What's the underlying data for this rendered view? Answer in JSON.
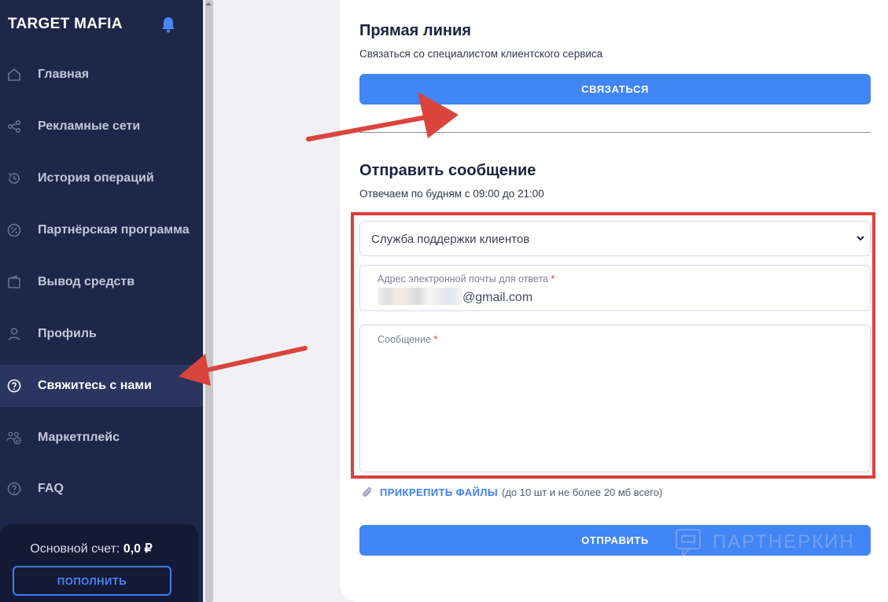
{
  "sidebar": {
    "brand": "TARGET MAFIA",
    "items": [
      {
        "label": "Главная",
        "icon": "home-icon"
      },
      {
        "label": "Рекламные сети",
        "icon": "share-icon"
      },
      {
        "label": "История операций",
        "icon": "history-icon"
      },
      {
        "label": "Партнёрская программа",
        "icon": "percent-icon"
      },
      {
        "label": "Вывод средств",
        "icon": "wallet-icon"
      },
      {
        "label": "Профиль",
        "icon": "user-icon"
      },
      {
        "label": "Свяжитесь с нами",
        "icon": "question-icon",
        "active": true
      },
      {
        "label": "Маркетплейс",
        "icon": "users-icon"
      },
      {
        "label": "FAQ",
        "icon": "question-icon"
      }
    ],
    "balance": {
      "label": "Основной счет:",
      "value": "0,0 ₽"
    },
    "topup_label": "ПОПОЛНИТЬ"
  },
  "hotline": {
    "title": "Прямая линия",
    "subtitle": "Связаться со специалистом клиентского сервиса",
    "button_label": "СВЯЗАТЬСЯ"
  },
  "message_form": {
    "title": "Отправить сообщение",
    "subtitle": "Отвечаем по будням с 09:00 до 21:00",
    "department_value": "Служба поддержки клиентов",
    "email_label": "Адрес электронной почты для ответа",
    "email_value_suffix": "@gmail.com",
    "message_label": "Сообщение",
    "required_mark": "*",
    "attach_link": "ПРИКРЕПИТЬ ФАЙЛЫ",
    "attach_note": "(до 10 шт и не более 20 мб всего)",
    "submit_label": "ОТПРАВИТЬ"
  },
  "watermark": "ПАРТНЕРКИН",
  "colors": {
    "sidebar_bg": "#1f2748",
    "accent_blue": "#4285f4",
    "annotation_red": "#d9403a"
  }
}
